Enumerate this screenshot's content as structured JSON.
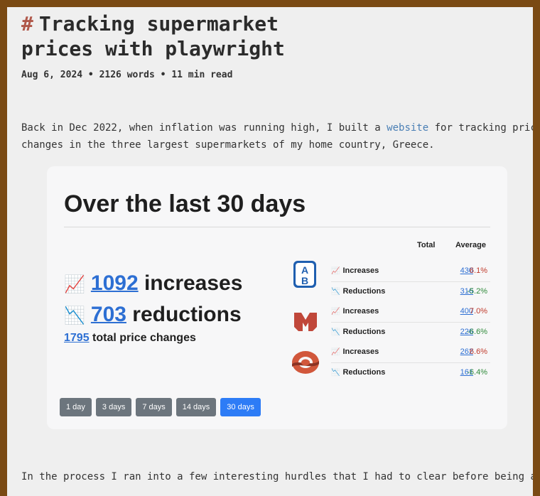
{
  "post": {
    "hash": "#",
    "title": "Tracking supermarket prices with playwright",
    "meta": "Aug 6, 2024 • 2126 words • 11 min read",
    "intro_before_link": "Back in Dec 2022, when inflation was running high, I built a ",
    "intro_link": "website",
    "intro_after_link": " for tracking price",
    "intro_line2": "changes in the three largest supermarkets of my home country, Greece.",
    "outro": "In the process I ran into a few interesting hurdles that I had to clear before being able"
  },
  "card": {
    "title": "Over the last 30 days",
    "increases_icon": "📈",
    "increases_count": "1092",
    "increases_label": " increases",
    "reductions_icon": "📉",
    "reductions_count": "703",
    "reductions_label": " reductions",
    "total_count": "1795",
    "total_label": " total price changes",
    "col_total": "Total",
    "col_average": "Average",
    "stores": [
      {
        "logo": "ab-logo",
        "rows": [
          {
            "icon": "📈",
            "label": "Increases",
            "total": "430",
            "average": "6.1%"
          },
          {
            "icon": "📉",
            "label": "Reductions",
            "total": "316",
            "average": "-5.2%"
          }
        ]
      },
      {
        "logo": "masoutis-logo",
        "rows": [
          {
            "icon": "📈",
            "label": "Increases",
            "total": "400",
            "average": "7.0%"
          },
          {
            "icon": "📉",
            "label": "Reductions",
            "total": "226",
            "average": "-6.6%"
          }
        ]
      },
      {
        "logo": "sklavenitis-logo",
        "rows": [
          {
            "icon": "📈",
            "label": "Increases",
            "total": "262",
            "average": "6.6%"
          },
          {
            "icon": "📉",
            "label": "Reductions",
            "total": "161",
            "average": "-6.4%"
          }
        ]
      }
    ],
    "ranges": [
      "1 day",
      "3 days",
      "7 days",
      "14 days",
      "30 days"
    ],
    "active_range": "30 days"
  },
  "colors": {
    "link": "#2d6fd3",
    "increase": "#c03a2b",
    "decrease": "#2f8a3a",
    "active_button": "#2d7cf6",
    "button": "#6c757d"
  }
}
